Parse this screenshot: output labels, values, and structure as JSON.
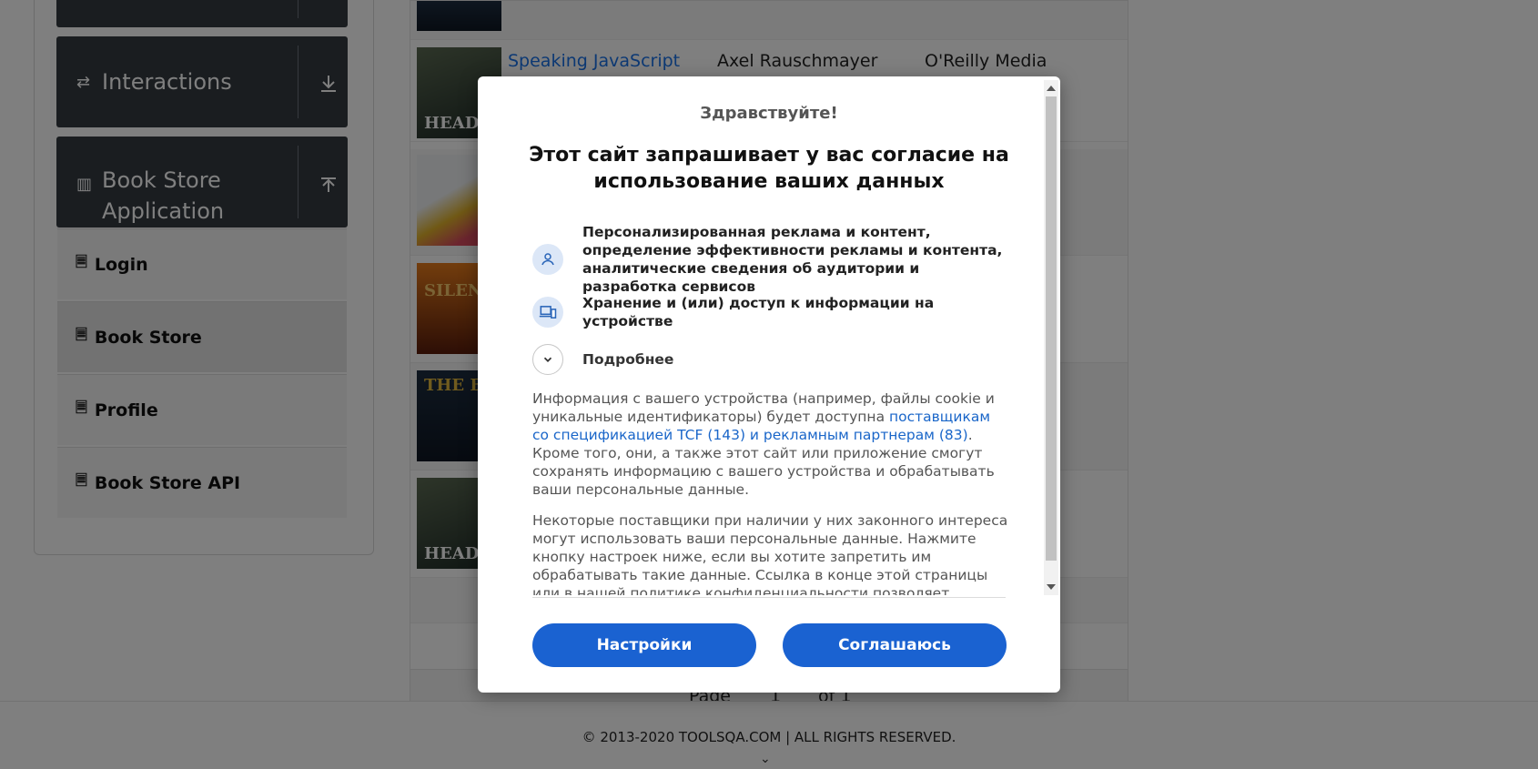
{
  "sidebar": {
    "groups": [
      {
        "title": "Interactions"
      },
      {
        "title_line1": "Book Store",
        "title_line2": "Application"
      }
    ],
    "items": [
      {
        "label": "Login"
      },
      {
        "label": "Book Store"
      },
      {
        "label": "Profile"
      },
      {
        "label": "Book Store API"
      }
    ]
  },
  "table": {
    "rows": [
      {
        "title": "Speaking JavaScript",
        "author": "Axel Rauschmayer",
        "publisher": "O'Reilly Media"
      }
    ],
    "thumb_labels": [
      "HEADE",
      "",
      "SILEN",
      "THE BE",
      "HEADE"
    ]
  },
  "pager": {
    "page_label": "Page",
    "page_value": "1",
    "of_label": "of 1"
  },
  "footer": {
    "text": "© 2013-2020 TOOLSQA.COM | ALL RIGHTS RESERVED."
  },
  "consent": {
    "hello": "Здравствуйте!",
    "headline": "Этот сайт запрашивает у вас согласие на использование ваших данных",
    "purposes": [
      {
        "icon": "person-icon",
        "text": "Персонализированная реклама и контент, определение эффективности рекламы и контента, аналитические сведения об аудитории и разработка сервисов"
      },
      {
        "icon": "devices-icon",
        "text": "Хранение и (или) доступ к информации на устройстве"
      },
      {
        "icon": "chevron-down-icon",
        "text": "Подробнее"
      }
    ],
    "info1_pre": "Информация с вашего устройства (например, файлы cookie и уникальные идентификаторы) будет доступна ",
    "info1_link": "поставщикам со спецификацией TCF (143) и рекламным партнерам (83)",
    "info1_post": ". Кроме того, они, а также этот сайт или приложение смогут сохранять информацию с вашего устройства и обрабатывать ваши персональные данные.",
    "info2": "Некоторые поставщики при наличии у них законного интереса могут использовать ваши персональные данные. Нажмите кнопку настроек ниже, если вы хотите запретить им обрабатывать такие данные. Ссылка в конце этой страницы или в нашей политике конфиденциальности позволяет отменить свое согласие.",
    "settings_label": "Настройки",
    "agree_label": "Соглашаюсь",
    "accent_color": "#1a62d1"
  }
}
